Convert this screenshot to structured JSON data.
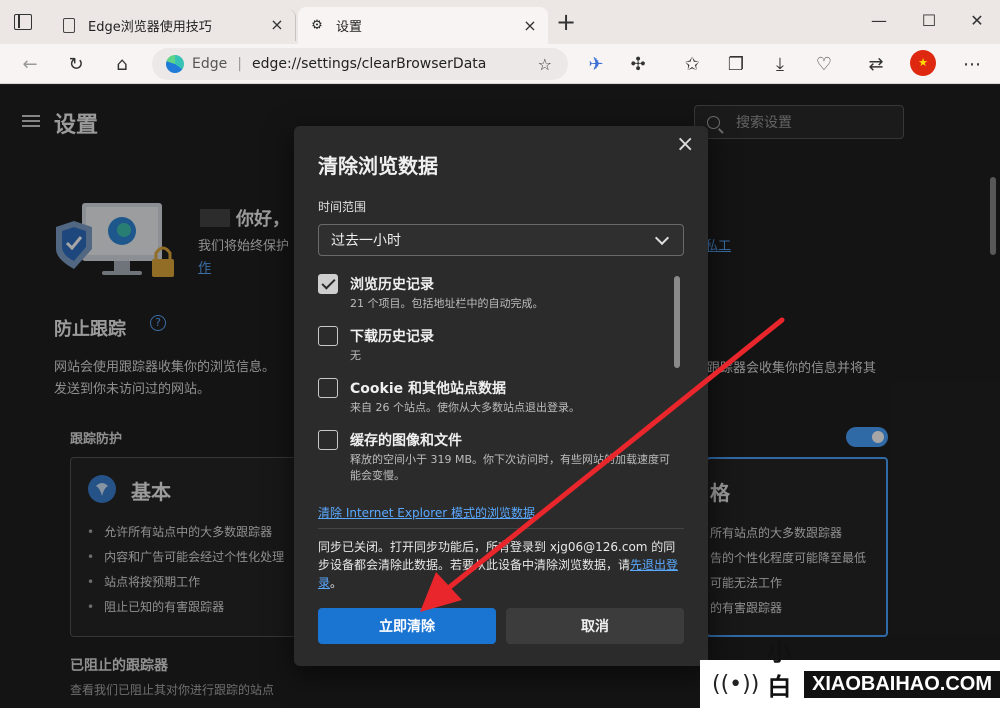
{
  "tabs": [
    {
      "label": "Edge浏览器使用技巧",
      "active": false
    },
    {
      "label": "设置",
      "active": true
    }
  ],
  "address": {
    "site": "Edge",
    "separator": "|",
    "url": "edge://settings/clearBrowserData"
  },
  "settings": {
    "title": "设置",
    "search_placeholder": "搜索设置",
    "greeting": "你好，",
    "greeting_sub": "我们将始终保护",
    "greeting_link": "作",
    "right_link": "私工",
    "section_title": "防止跟踪",
    "section_desc_1": "网站会使用跟踪器收集你的浏览信息。",
    "section_desc_2": "发送到你未访问过的网站。",
    "section_desc_right": "跟踪器会收集你的信息并将其",
    "tracking_label": "跟踪防护",
    "basic_card": {
      "title": "基本",
      "items": [
        "允许所有站点中的大多数跟踪器",
        "内容和广告可能会经过个性化处理",
        "站点将按预期工作",
        "阻止已知的有害跟踪器"
      ]
    },
    "strict_card": {
      "title": "格",
      "items": [
        "所有站点的大多数跟踪器",
        "告的个性化程度可能降至最低",
        "可能无法工作",
        "的有害跟踪器"
      ]
    },
    "blocked_title": "已阻止的跟踪器",
    "blocked_sub": "查看我们已阻止其对你进行跟踪的站点"
  },
  "dialog": {
    "title": "清除浏览数据",
    "range_label": "时间范围",
    "range_value": "过去一小时",
    "options": [
      {
        "title": "浏览历史记录",
        "desc": "21 个项目。包括地址栏中的自动完成。",
        "checked": true
      },
      {
        "title": "下载历史记录",
        "desc": "无",
        "checked": false
      },
      {
        "title": "Cookie 和其他站点数据",
        "desc": "来自 26 个站点。使你从大多数站点退出登录。",
        "checked": false
      },
      {
        "title": "缓存的图像和文件",
        "desc": "释放的空间小于 319 MB。你下次访问时，有些网站的加载速度可能会变慢。",
        "checked": false
      }
    ],
    "ie_link": "清除 Internet Explorer 模式的浏览数据",
    "sync_text_1": "同步已关闭。打开同步功能后，所有登录到 xjg06@126.com 的同步设备都会清除此数据。若要从此设备中清除浏览数据，请",
    "sync_link": "先退出登录",
    "sync_text_2": "。",
    "primary_button": "立即清除",
    "secondary_button": "取消"
  },
  "brand": {
    "zh": "小白号",
    "en": "XIAOBAIHAO.COM"
  },
  "colors": {
    "accent": "#1a74d2",
    "link": "#5aa9ff",
    "annotation_arrow": "#e8262b"
  }
}
